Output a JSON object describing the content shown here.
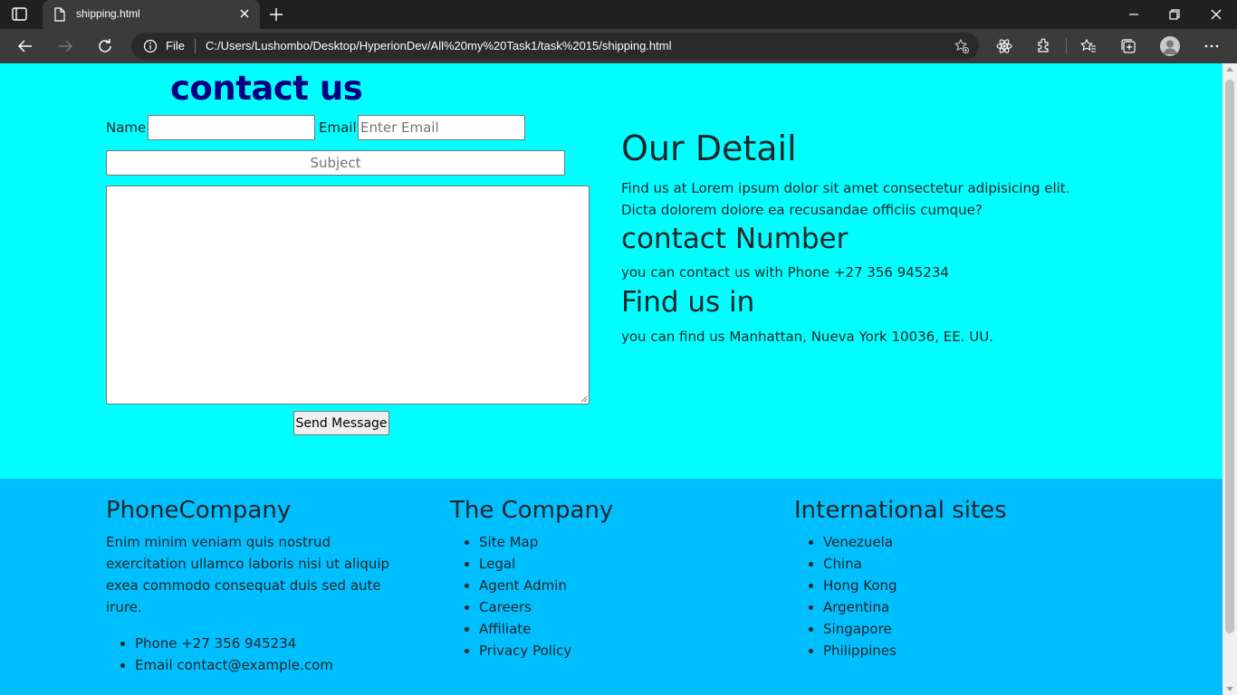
{
  "browser": {
    "tab_title": "shipping.html",
    "address_scheme": "File",
    "url": "C:/Users/Lushombo/Desktop/HyperionDev/All%20my%20Task1/task%2015/shipping.html"
  },
  "contact_form": {
    "title": "contact us",
    "name_label": "Name",
    "name_value": "",
    "email_label": "Email",
    "email_placeholder": "Enter Email",
    "subject_placeholder": "Subject",
    "message_value": "",
    "send_label": "Send Message"
  },
  "details": {
    "heading": "Our Detail",
    "text": "Find us at Lorem ipsum dolor sit amet consectetur adipisicing elit. Dicta dolorem dolore ea recusandae officiis cumque?",
    "contact_heading": "contact Number",
    "contact_text": "you can contact us with Phone +27 356 945234",
    "find_heading": "Find us in",
    "find_text": "you can find us Manhattan, Nueva York 10036, EE. UU."
  },
  "footer": {
    "company": {
      "heading": "PhoneCompany",
      "text": "Enim minim veniam quis nostrud exercitation ullamco laboris nisi ut aliquip exea commodo consequat duis sed aute irure.",
      "contacts": [
        "Phone +27 356 945234",
        "Email contact@example.com"
      ]
    },
    "the_company": {
      "heading": "The Company",
      "links": [
        "Site Map",
        "Legal",
        "Agent Admin",
        "Careers",
        "Affiliate",
        "Privacy Policy"
      ]
    },
    "international": {
      "heading": "International sites",
      "links": [
        "Venezuela",
        "China",
        "Hong Kong",
        "Argentina",
        "Singapore",
        "Philippines"
      ]
    }
  },
  "colors": {
    "page_bg": "#00ffff",
    "footer_bg": "#00bfff",
    "title_color": "#000080"
  }
}
